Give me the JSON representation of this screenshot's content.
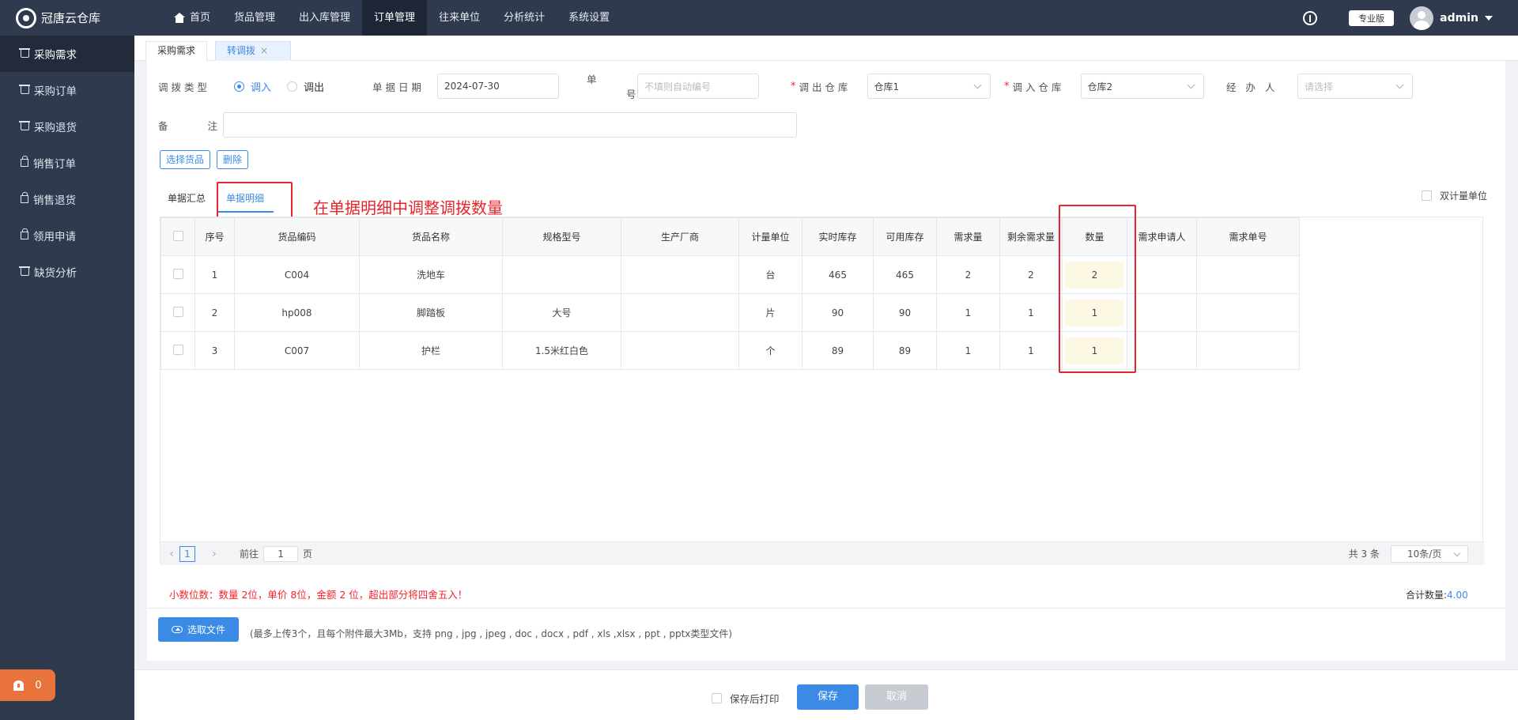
{
  "app": {
    "title": "冠唐云仓库"
  },
  "nav": [
    {
      "label": "首页",
      "icon": "home-icon"
    },
    {
      "label": "货品管理"
    },
    {
      "label": "出入库管理"
    },
    {
      "label": "订单管理",
      "active": true
    },
    {
      "label": "往来单位"
    },
    {
      "label": "分析统计"
    },
    {
      "label": "系统设置"
    }
  ],
  "header": {
    "edition": "专业版",
    "user": "admin"
  },
  "sidebar": {
    "items": [
      {
        "label": "采购需求",
        "icon": "cart-icon",
        "active": true
      },
      {
        "label": "采购订单",
        "icon": "cart-icon"
      },
      {
        "label": "采购退货",
        "icon": "cart-icon"
      },
      {
        "label": "销售订单",
        "icon": "bag-icon"
      },
      {
        "label": "销售退货",
        "icon": "bag-icon"
      },
      {
        "label": "领用申请",
        "icon": "box-icon"
      },
      {
        "label": "缺货分析",
        "icon": "cart-icon"
      }
    ],
    "alarm_count": "0"
  },
  "tabs": [
    {
      "label": "采购需求"
    },
    {
      "label": "转调拨",
      "active": true,
      "close": "×"
    }
  ],
  "form": {
    "transfer_type_label": "调 拨 类 型",
    "transfer_in": "调入",
    "transfer_out": "调出",
    "date_label": "单 据 日 期",
    "date_value": "2024-07-30",
    "number_label_a": "单",
    "number_label_b": "号",
    "number_placeholder": "不填则自动编号",
    "out_wh_label": "调 出 仓 库",
    "out_wh_value": "仓库1",
    "in_wh_label": "调 入 仓 库",
    "in_wh_value": "仓库2",
    "handler_label": "经   办   人",
    "handler_placeholder": "请选择",
    "remark_label_a": "备",
    "remark_label_b": "注",
    "required_mark": "*"
  },
  "actions": {
    "select_goods": "选择货品",
    "delete": "删除"
  },
  "subtabs": {
    "summary": "单据汇总",
    "detail": "单据明细"
  },
  "annotation": "在单据明细中调整调拨数量",
  "dual_unit": "双计量单位",
  "table": {
    "headers": [
      "序号",
      "货品编码",
      "货品名称",
      "规格型号",
      "生产厂商",
      "计量单位",
      "实时库存",
      "可用库存",
      "需求量",
      "剩余需求量",
      "数量",
      "需求申请人",
      "需求单号"
    ],
    "rows": [
      {
        "no": "1",
        "code": "C004",
        "name": "洗地车",
        "spec": "",
        "maker": "",
        "unit": "台",
        "stock": "465",
        "avail": "465",
        "demand": "2",
        "remain": "2",
        "qty": "2",
        "applicant": "",
        "order": ""
      },
      {
        "no": "2",
        "code": "hp008",
        "name": "脚踏板",
        "spec": "大号",
        "maker": "",
        "unit": "片",
        "stock": "90",
        "avail": "90",
        "demand": "1",
        "remain": "1",
        "qty": "1",
        "applicant": "",
        "order": ""
      },
      {
        "no": "3",
        "code": "C007",
        "name": "护栏",
        "spec": "1.5米红白色",
        "maker": "",
        "unit": "个",
        "stock": "89",
        "avail": "89",
        "demand": "1",
        "remain": "1",
        "qty": "1",
        "applicant": "",
        "order": ""
      }
    ]
  },
  "pager": {
    "prev": "‹",
    "page": "1",
    "next": "›",
    "goto_label": "前往",
    "goto_value": "1",
    "page_suffix": "页",
    "total": "共 3 条",
    "page_size": "10条/页"
  },
  "notice": "小数位数：数量 2位，单价 8位，金额 2 位，超出部分将四舍五入！",
  "total": {
    "label": "合计数量:",
    "value": "4.00"
  },
  "upload": {
    "button": "选取文件",
    "hint": "(最多上传3个，且每个附件最大3Mb，支持 png , jpg , jpeg , doc , docx , pdf , xls ,xlsx , ppt , pptx类型文件)"
  },
  "footer": {
    "print_after_save": "保存后打印",
    "save": "保存",
    "cancel": "取消"
  }
}
